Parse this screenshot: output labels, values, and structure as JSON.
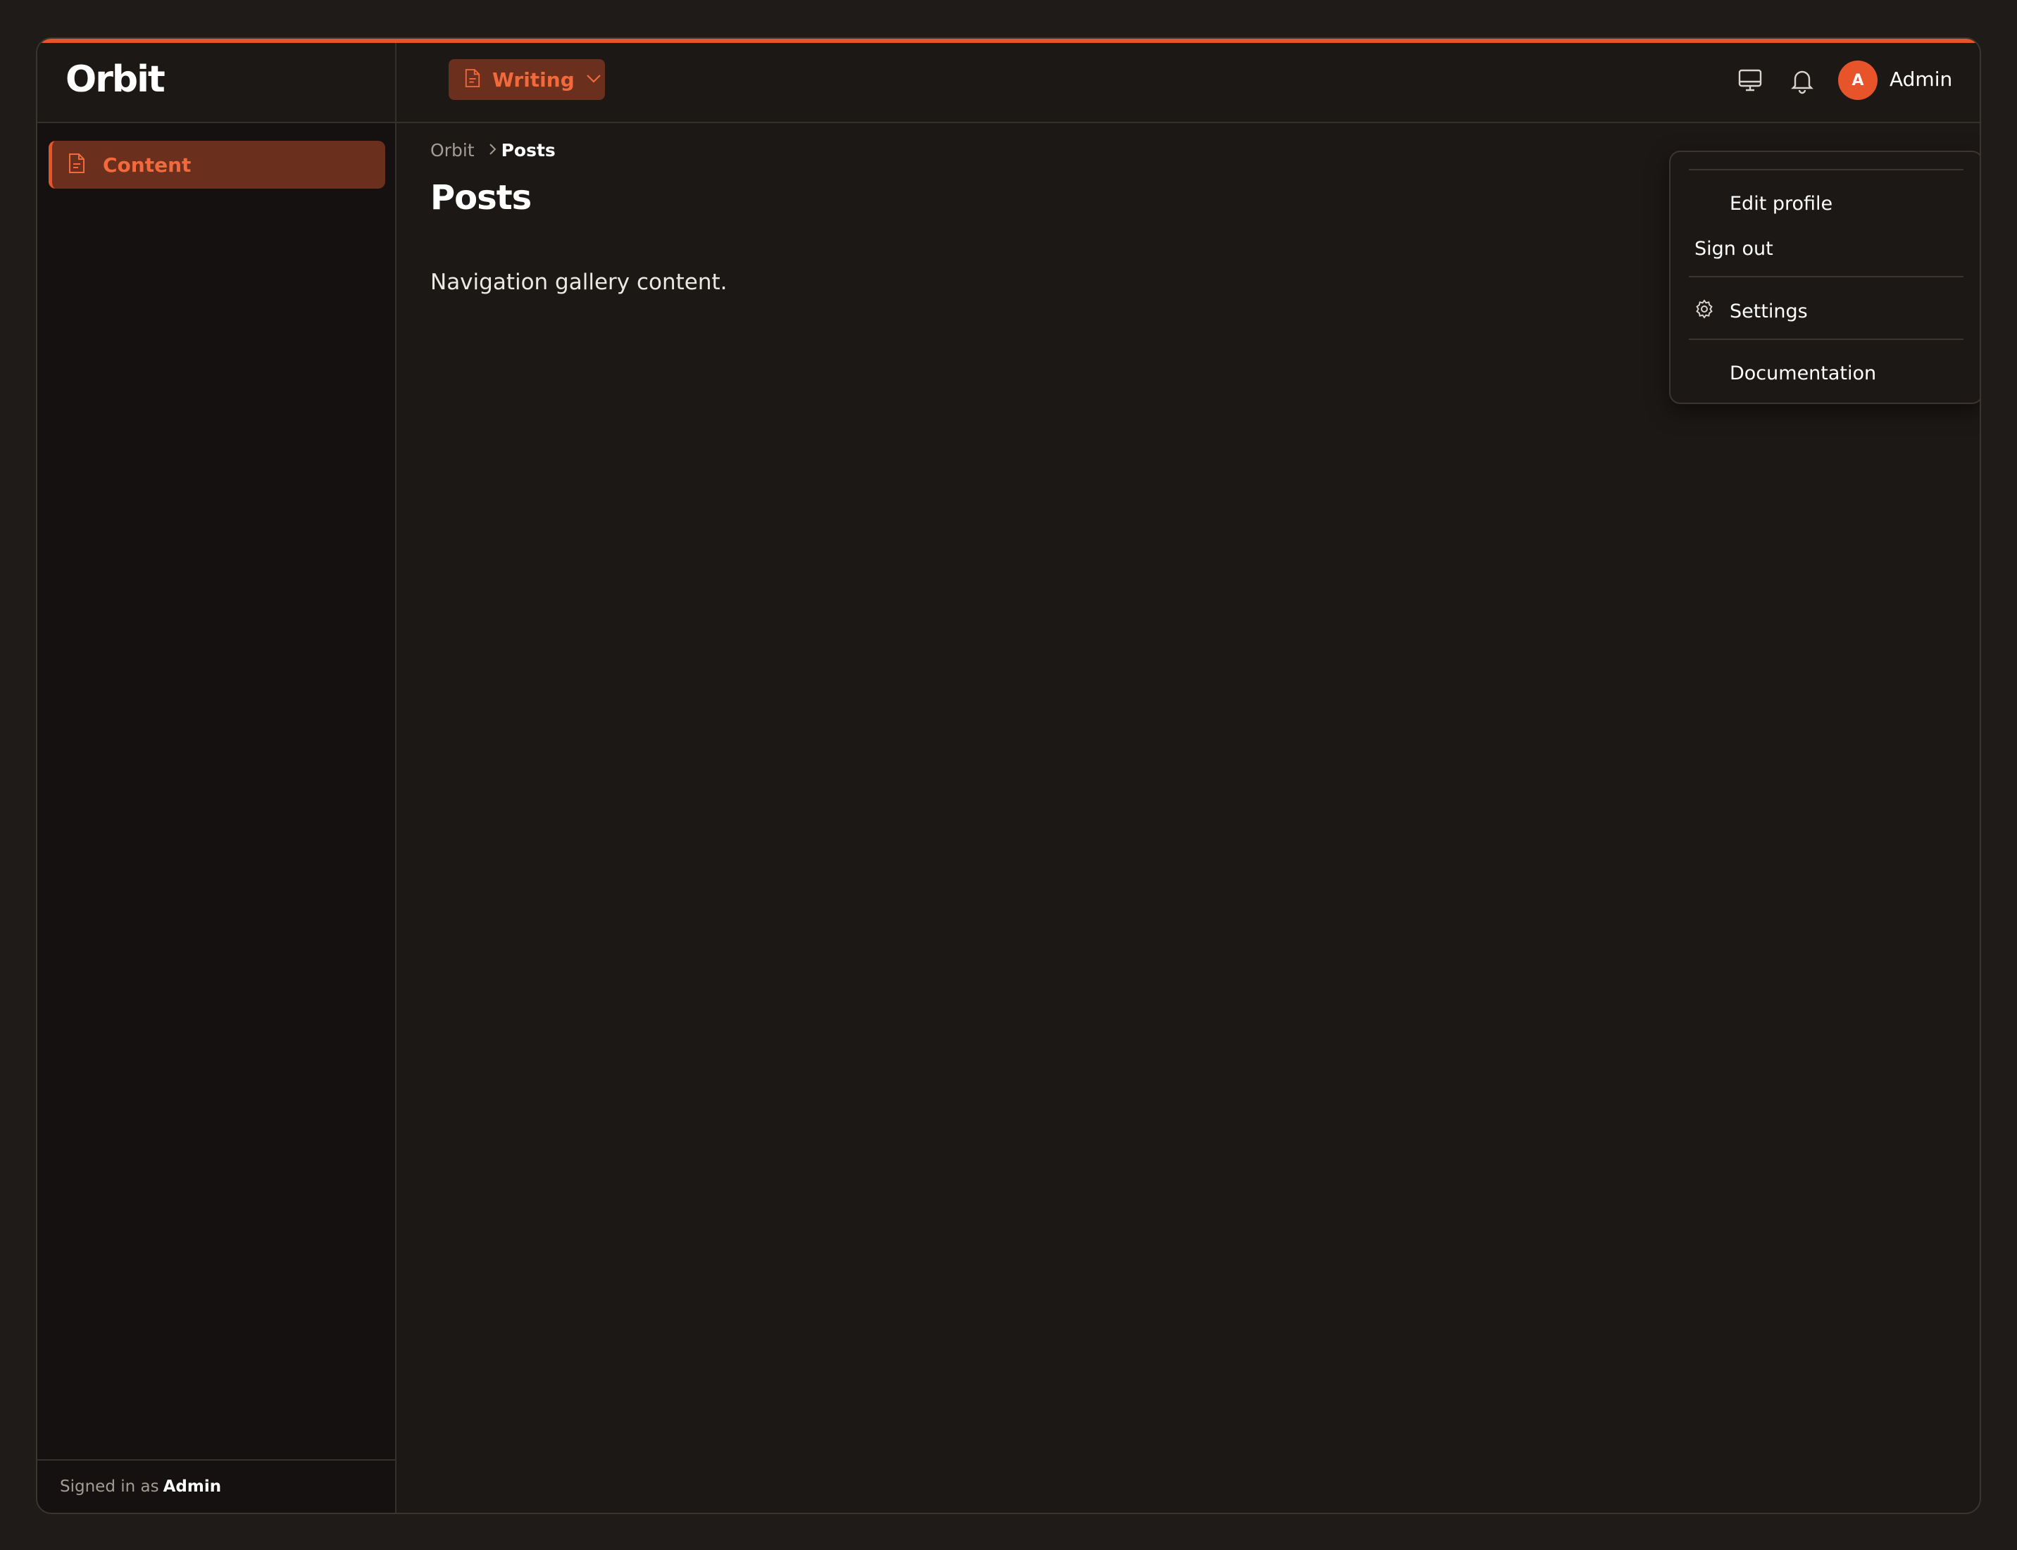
{
  "brand": {
    "name": "Orbit"
  },
  "sidebar": {
    "items": [
      {
        "label": "Content",
        "icon": "document-icon",
        "active": true
      }
    ],
    "footer": {
      "prefix": "Signed in as",
      "user": "Admin"
    }
  },
  "topbar": {
    "workspace": {
      "label": "Writing",
      "icon": "document-icon"
    },
    "icons": [
      "monitor-icon",
      "bell-icon"
    ],
    "user": {
      "initial": "A",
      "name": "Admin"
    }
  },
  "breadcrumb": {
    "root": "Orbit",
    "current": "Posts"
  },
  "page": {
    "title": "Posts",
    "body": "Navigation gallery content."
  },
  "user_menu": {
    "items": [
      {
        "label": "Edit profile"
      },
      {
        "label": "Sign out"
      },
      {
        "label": "Settings",
        "icon": "gear-icon"
      },
      {
        "label": "Documentation"
      }
    ]
  },
  "colors": {
    "accent": "#e8542a",
    "accent_text": "#f26a3c",
    "active_bg": "#6b2f1d"
  }
}
